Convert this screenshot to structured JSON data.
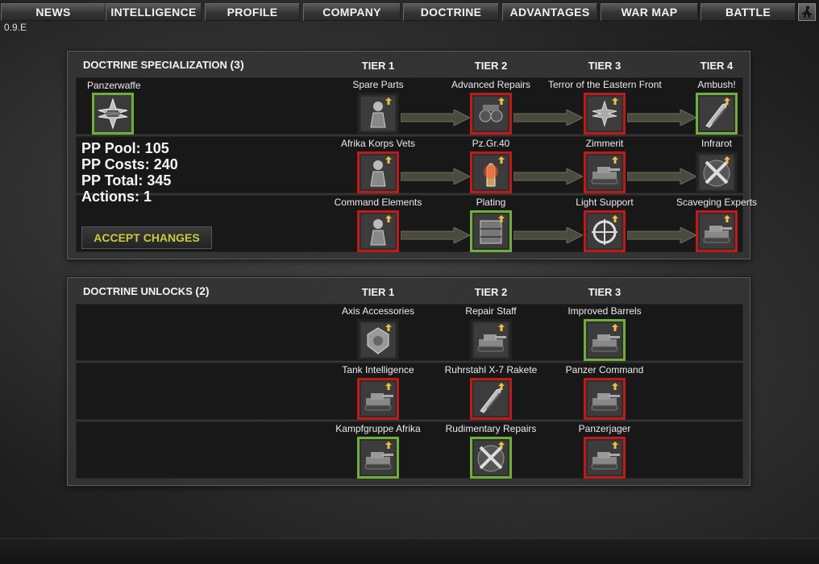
{
  "nav": {
    "items": [
      "NEWS",
      "INTELLIGENCE",
      "PROFILE",
      "COMPANY",
      "DOCTRINE",
      "ADVANTAGES",
      "WAR MAP",
      "BATTLE"
    ],
    "icon": "running-soldier-icon"
  },
  "version": "0.9.E",
  "specialization": {
    "title": "DOCTRINE SPECIALIZATION",
    "count": "(3)",
    "tiers": [
      "TIER 1",
      "TIER 2",
      "TIER 3",
      "TIER 4"
    ],
    "doctrine_name": "Panzerwaffe",
    "stats": {
      "pool": "PP Pool: 105",
      "costs": "PP Costs: 240",
      "total": "PP Total: 345",
      "actions": "Actions: 1"
    },
    "accept_label": "ACCEPT CHANGES",
    "rows": [
      [
        {
          "name": "Spare Parts",
          "state": "none",
          "icon": "wrench-soldier-icon"
        },
        {
          "name": "Advanced Repairs",
          "state": "red",
          "icon": "binoculars-icon"
        },
        {
          "name": "Terror of the Eastern Front",
          "state": "red",
          "icon": "iron-cross-icon"
        },
        {
          "name": "Ambush!",
          "state": "green",
          "icon": "rocket-icon"
        }
      ],
      [
        {
          "name": "Afrika Korps Vets",
          "state": "red",
          "icon": "veteran-soldier-icon"
        },
        {
          "name": "Pz.Gr.40",
          "state": "red",
          "icon": "shell-icon"
        },
        {
          "name": "Zimmerit",
          "state": "red",
          "icon": "tank-icon"
        },
        {
          "name": "Infrarot",
          "state": "none",
          "icon": "crossed-rifles-icon"
        }
      ],
      [
        {
          "name": "Command Elements",
          "state": "red",
          "icon": "officer-icon"
        },
        {
          "name": "Plating",
          "state": "green",
          "icon": "armor-plate-icon"
        },
        {
          "name": "Light Support",
          "state": "red",
          "icon": "crosshair-icon"
        },
        {
          "name": "Scaveging Experts",
          "state": "red",
          "icon": "halftrack-icon"
        }
      ]
    ]
  },
  "unlocks": {
    "title": "DOCTRINE UNLOCKS",
    "count": "(2)",
    "tiers": [
      "TIER 1",
      "TIER 2",
      "TIER 3"
    ],
    "rows": [
      [
        {
          "name": "Axis Accessories",
          "state": "none",
          "icon": "medal-icon"
        },
        {
          "name": "Repair Staff",
          "state": "none",
          "icon": "repair-tank-icon"
        },
        {
          "name": "Improved Barrels",
          "state": "green",
          "icon": "tank-barrel-icon"
        }
      ],
      [
        {
          "name": "Tank Intelligence",
          "state": "red",
          "icon": "tank-star-icon"
        },
        {
          "name": "Ruhrstahl X-7 Rakete",
          "state": "red",
          "icon": "missile-icon"
        },
        {
          "name": "Panzer Command",
          "state": "red",
          "icon": "command-tank-icon"
        }
      ],
      [
        {
          "name": "Kampfgruppe Afrika",
          "state": "green",
          "icon": "afrika-tank-icon"
        },
        {
          "name": "Rudimentary Repairs",
          "state": "green",
          "icon": "tools-icon"
        },
        {
          "name": "Panzerjager",
          "state": "red",
          "icon": "tank-destroyer-icon"
        }
      ]
    ]
  }
}
